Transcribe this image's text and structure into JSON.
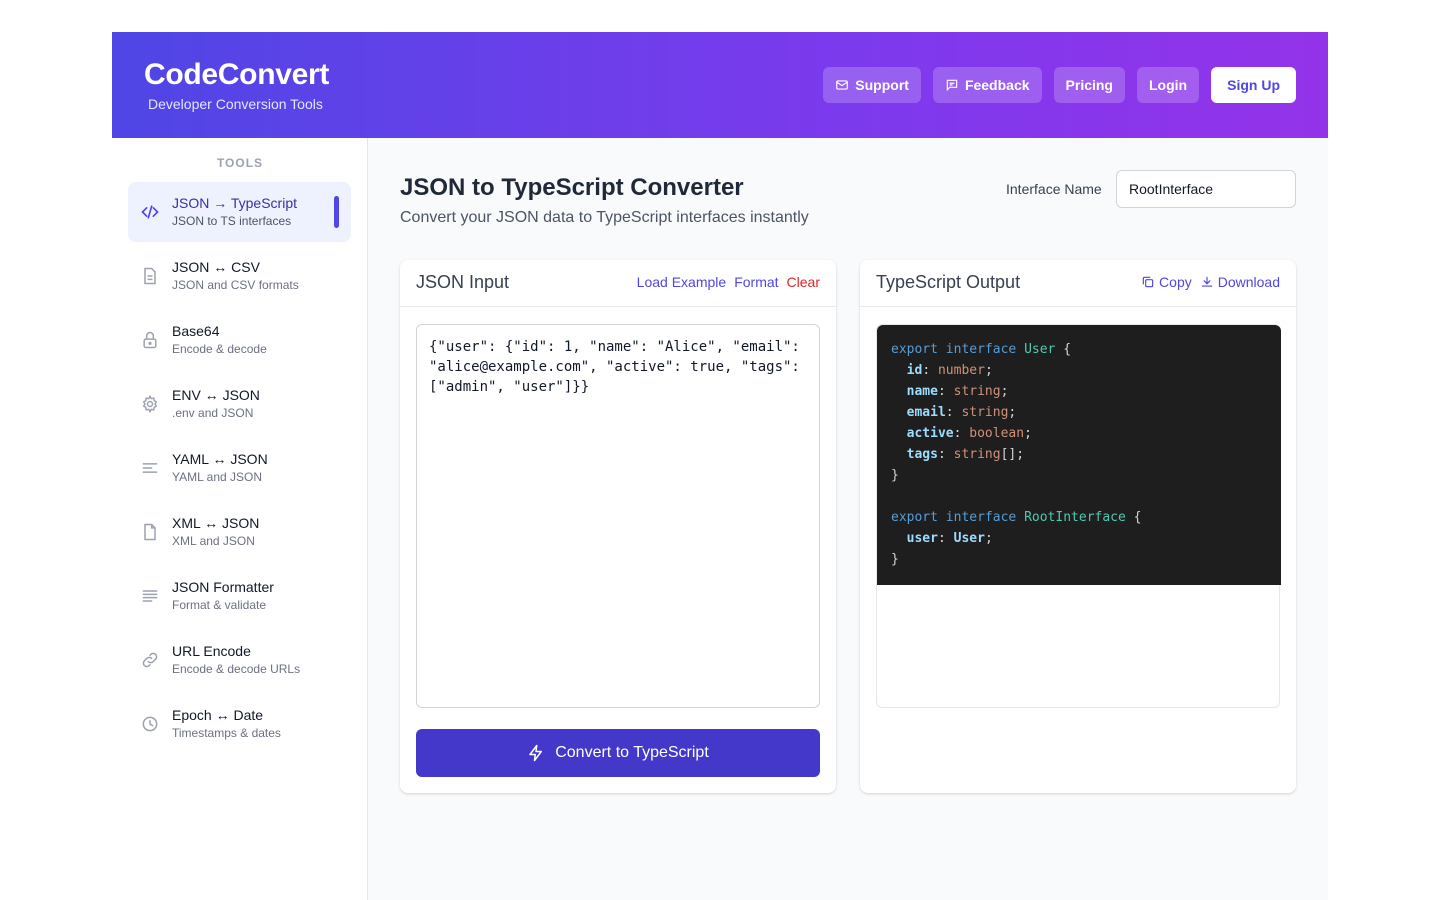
{
  "header": {
    "title": "CodeConvert",
    "subtitle": "Developer Conversion Tools",
    "nav": [
      {
        "label": "Support",
        "icon": "mail-icon"
      },
      {
        "label": "Feedback",
        "icon": "message-icon"
      },
      {
        "label": "Pricing"
      },
      {
        "label": "Login"
      },
      {
        "label": "Sign Up"
      }
    ]
  },
  "sidebar": {
    "heading": "TOOLS",
    "items": [
      {
        "label": "JSON → TypeScript",
        "sub": "JSON to TS interfaces",
        "icon": "code-icon",
        "active": true
      },
      {
        "label": "JSON ↔ CSV",
        "sub": "JSON and CSV formats",
        "icon": "file-text-icon"
      },
      {
        "label": "Base64",
        "sub": "Encode & decode",
        "icon": "lock-icon"
      },
      {
        "label": "ENV ↔ JSON",
        "sub": ".env and JSON",
        "icon": "gear-icon"
      },
      {
        "label": "YAML ↔ JSON",
        "sub": "YAML and JSON",
        "icon": "align-left-icon"
      },
      {
        "label": "XML ↔ JSON",
        "sub": "XML and JSON",
        "icon": "file-icon"
      },
      {
        "label": "JSON Formatter",
        "sub": "Format & validate",
        "icon": "lines-icon"
      },
      {
        "label": "URL Encode",
        "sub": "Encode & decode URLs",
        "icon": "link-icon"
      },
      {
        "label": "Epoch ↔ Date",
        "sub": "Timestamps & dates",
        "icon": "clock-icon"
      }
    ]
  },
  "main": {
    "title": "JSON to TypeScript Converter",
    "subtitle": "Convert your JSON data to TypeScript interfaces instantly",
    "interface_label": "Interface Name",
    "interface_value": "RootInterface"
  },
  "input_panel": {
    "title": "JSON Input",
    "actions": {
      "load": "Load Example",
      "format": "Format",
      "clear": "Clear"
    },
    "value": "{\"user\": {\"id\": 1, \"name\": \"Alice\", \"email\": \"alice@example.com\", \"active\": true, \"tags\": [\"admin\", \"user\"]}}",
    "convert_label": "Convert to TypeScript"
  },
  "output_panel": {
    "title": "TypeScript Output",
    "actions": {
      "copy": "Copy",
      "download": "Download"
    },
    "code": {
      "export": "export",
      "interface": "interface",
      "user_type": "User",
      "root_type": "RootInterface",
      "fields": [
        {
          "name": "id",
          "type": "number",
          "suffix": ";"
        },
        {
          "name": "name",
          "type": "string",
          "suffix": ";"
        },
        {
          "name": "email",
          "type": "string",
          "suffix": ";"
        },
        {
          "name": "active",
          "type": "boolean",
          "suffix": ";"
        },
        {
          "name": "tags",
          "type": "string",
          "suffix": "[];"
        }
      ],
      "root_field": {
        "name": "user",
        "type": "User",
        "suffix": ";"
      },
      "open": " {",
      "close": "}"
    }
  }
}
